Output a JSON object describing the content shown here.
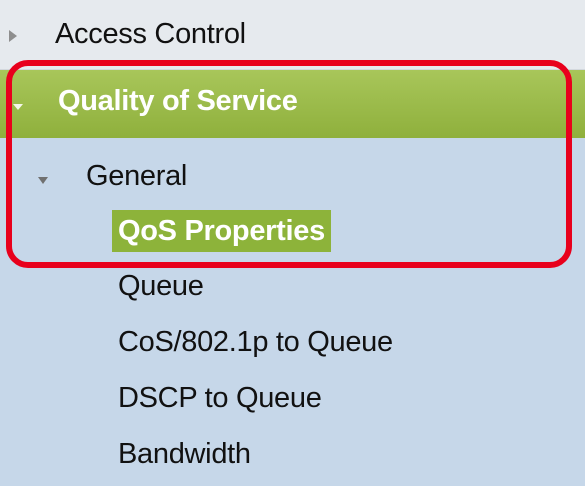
{
  "nav": {
    "access_control": {
      "label": "Access Control",
      "icon": "triangle-right-icon"
    },
    "quality_of_service": {
      "label": "Quality of Service",
      "icon": "triangle-down-icon",
      "color": "#8fb03c"
    },
    "general": {
      "label": "General",
      "icon": "triangle-down-icon"
    },
    "items": [
      {
        "label": "QoS Properties",
        "selected": true
      },
      {
        "label": "Queue"
      },
      {
        "label": "CoS/802.1p to Queue"
      },
      {
        "label": "DSCP to Queue"
      },
      {
        "label": "Bandwidth"
      }
    ]
  },
  "annotation": {
    "color": "#e8001c"
  }
}
